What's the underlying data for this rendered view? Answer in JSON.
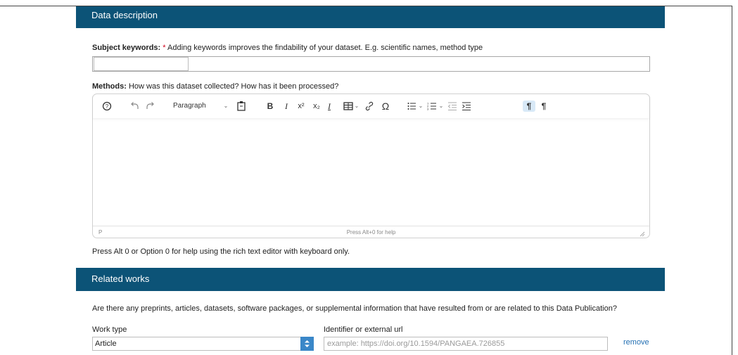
{
  "data_description": {
    "header": "Data description",
    "keywords": {
      "label": "Subject keywords:",
      "required_mark": "*",
      "hint": "Adding keywords improves the findability of your dataset. E.g. scientific names, method type",
      "value": ""
    },
    "methods": {
      "label": "Methods:",
      "hint": "How was this dataset collected? How has it been processed?"
    }
  },
  "editor": {
    "toolbar": {
      "block_format": "Paragraph",
      "help_icon": "help-circle-icon",
      "undo_icon": "undo-icon",
      "redo_icon": "redo-icon",
      "paste_icon": "paste-icon",
      "bold": "B",
      "italic": "I",
      "superscript": "x²",
      "subscript": "x₂",
      "clear_format": "I",
      "table_icon": "table-icon",
      "link_icon": "link-icon",
      "omega": "Ω",
      "ltr": "¶",
      "rtl": "¶"
    },
    "status_element": "P",
    "status_help": "Press Alt+0 for help"
  },
  "help_note": "Press Alt 0 or Option 0 for help using the rich text editor with keyboard only.",
  "related_works": {
    "header": "Related works",
    "question": "Are there any preprints, articles, datasets, software packages, or supplemental information that have resulted from or are related to this Data Publication?",
    "work_type_label": "Work type",
    "work_type_value": "Article",
    "identifier_label": "Identifier or external url",
    "identifier_placeholder": "example: https://doi.org/10.1594/PANGAEA.726855",
    "remove": "remove"
  },
  "colors": {
    "section_header_bg": "#0c5377",
    "required": "#d0021b",
    "link": "#2470b3",
    "select_spinner": "#3a87c8",
    "active_toolbar": "#d8e9f7"
  }
}
